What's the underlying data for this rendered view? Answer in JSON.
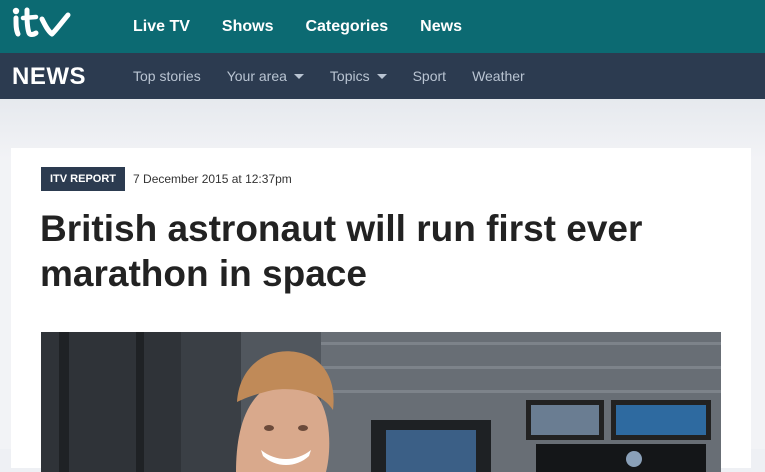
{
  "topbar": {
    "logo": "itv-logo",
    "nav": [
      "Live TV",
      "Shows",
      "Categories",
      "News"
    ]
  },
  "newsbar": {
    "brand": "NEWS",
    "items": [
      {
        "label": "Top stories",
        "dropdown": false
      },
      {
        "label": "Your area",
        "dropdown": true
      },
      {
        "label": "Topics",
        "dropdown": true
      },
      {
        "label": "Sport",
        "dropdown": false
      },
      {
        "label": "Weather",
        "dropdown": false
      }
    ]
  },
  "article": {
    "badge": "ITV REPORT",
    "date": "7 December 2015 at 12:37pm",
    "headline": "British astronaut will run first ever marathon in space"
  },
  "colors": {
    "topbar": "#0c6a72",
    "newsbar": "#2c3b50",
    "subnav_text": "#b9c4d2"
  }
}
